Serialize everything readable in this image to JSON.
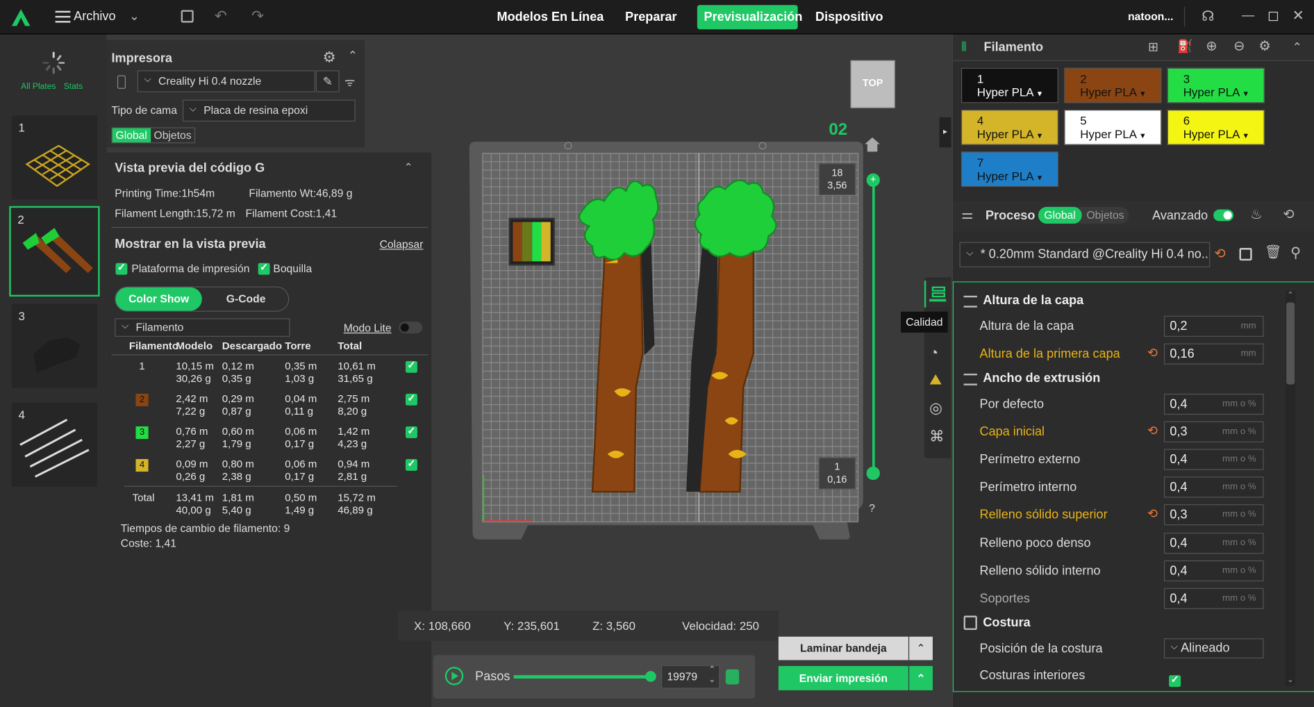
{
  "topbar": {
    "file_label": "Archivo",
    "tabs": [
      "Modelos En Línea",
      "Preparar",
      "Previsualización",
      "Dispositivo"
    ],
    "active_tab": "Previsualización",
    "user": "natoon..."
  },
  "plates": {
    "all_plates": "All Plates",
    "stats": "Stats",
    "items": [
      "1",
      "2",
      "3",
      "4"
    ]
  },
  "printer": {
    "title": "Impresora",
    "printer_name": "Creality Hi 0.4 nozzle",
    "bed_label": "Tipo de cama",
    "bed_value": "Placa de resina epoxi",
    "tab_global": "Global",
    "tab_objects": "Objetos"
  },
  "gcode": {
    "title": "Vista previa del código G",
    "printing_time": "Printing Time:1h54m",
    "filament_wt": "Filamento Wt:46,89 g",
    "filament_length": "Filament Length:15,72 m",
    "filament_cost": "Filament Cost:1,41",
    "show_title": "Mostrar en la vista previa",
    "collapse": "Colapsar",
    "check_platform": "Plataforma de impresión",
    "check_nozzle": "Boquilla",
    "btn_color_show": "Color Show",
    "btn_gcode": "G-Code",
    "filter": "Filamento",
    "modo_lite": "Modo Lite",
    "headers": [
      "Filamento",
      "Modelo",
      "Descargado",
      "Torre",
      "Total"
    ],
    "rows": [
      {
        "id": "1",
        "color": "",
        "modelo": [
          "10,15 m",
          "30,26 g"
        ],
        "descargado": [
          "0,12 m",
          "0,35 g"
        ],
        "torre": [
          "0,35 m",
          "1,03 g"
        ],
        "total": [
          "10,61 m",
          "31,65 g"
        ]
      },
      {
        "id": "2",
        "color": "#8b4513",
        "modelo": [
          "2,42 m",
          "7,22 g"
        ],
        "descargado": [
          "0,29 m",
          "0,87 g"
        ],
        "torre": [
          "0,04 m",
          "0,11 g"
        ],
        "total": [
          "2,75 m",
          "8,20 g"
        ]
      },
      {
        "id": "3",
        "color": "#22dd44",
        "modelo": [
          "0,76 m",
          "2,27 g"
        ],
        "descargado": [
          "0,60 m",
          "1,79 g"
        ],
        "torre": [
          "0,06 m",
          "0,17 g"
        ],
        "total": [
          "1,42 m",
          "4,23 g"
        ]
      },
      {
        "id": "4",
        "color": "#d4b52a",
        "modelo": [
          "0,09 m",
          "0,26 g"
        ],
        "descargado": [
          "0,80 m",
          "2,38 g"
        ],
        "torre": [
          "0,06 m",
          "0,17 g"
        ],
        "total": [
          "0,94 m",
          "2,81 g"
        ]
      }
    ],
    "total_row": {
      "label": "Total",
      "modelo": [
        "13,41 m",
        "40,00 g"
      ],
      "descargado": [
        "1,81 m",
        "5,40 g"
      ],
      "torre": [
        "0,50 m",
        "1,49 g"
      ],
      "total": [
        "15,72 m",
        "46,89 g"
      ]
    },
    "changes": "Tiempos de cambio de filamento:  9",
    "cost": "Coste:  1,41"
  },
  "viewport": {
    "view_cube": "TOP",
    "plate_number": "02",
    "layer_top": [
      "18",
      "3,56"
    ],
    "layer_bottom": [
      "1",
      "0,16"
    ],
    "quality_tooltip": "Calidad",
    "help": "?",
    "coords": {
      "x": "X: 108,660",
      "y": "Y: 235,601",
      "z": "Z: 3,560",
      "speed": "Velocidad: 250"
    },
    "steps_label": "Pasos",
    "steps_value": "19979",
    "steps_fraction": 1.0
  },
  "actions": {
    "slice": "Laminar bandeja",
    "send": "Enviar impresión"
  },
  "filament_panel": {
    "title": "Filamento",
    "items": [
      {
        "n": "1",
        "name": "Hyper PLA",
        "bg": "#111111",
        "fg": "#ffffff"
      },
      {
        "n": "2",
        "name": "Hyper PLA",
        "bg": "#8b4513",
        "fg": "#111111"
      },
      {
        "n": "3",
        "name": "Hyper PLA",
        "bg": "#22dd44",
        "fg": "#111111"
      },
      {
        "n": "4",
        "name": "Hyper PLA",
        "bg": "#d4b52a",
        "fg": "#111111"
      },
      {
        "n": "5",
        "name": "Hyper PLA",
        "bg": "#ffffff",
        "fg": "#111111"
      },
      {
        "n": "6",
        "name": "Hyper PLA",
        "bg": "#f5f514",
        "fg": "#111111"
      },
      {
        "n": "7",
        "name": "Hyper PLA",
        "bg": "#1e7fc8",
        "fg": "#111111"
      }
    ]
  },
  "process": {
    "title": "Proceso",
    "tab_global": "Global",
    "tab_objects": "Objetos",
    "advanced": "Avanzado",
    "preset": "* 0.20mm Standard @Creality Hi 0.4 no...",
    "layer_section": "Altura de la capa",
    "layer_height_label": "Altura de la capa",
    "layer_height_value": "0,2",
    "first_layer_label": "Altura de la primera capa",
    "first_layer_value": "0,16",
    "unit_mm": "mm",
    "unit_mmpct": "mm o %",
    "width_section": "Ancho de extrusión",
    "widths": [
      {
        "label": "Por defecto",
        "value": "0,4",
        "mod": false
      },
      {
        "label": "Capa inicial",
        "value": "0,3",
        "mod": true
      },
      {
        "label": "Perímetro externo",
        "value": "0,4",
        "mod": false
      },
      {
        "label": "Perímetro interno",
        "value": "0,4",
        "mod": false
      },
      {
        "label": "Relleno sólido superior",
        "value": "0,3",
        "mod": true
      },
      {
        "label": "Relleno poco denso",
        "value": "0,4",
        "mod": false
      },
      {
        "label": "Relleno sólido interno",
        "value": "0,4",
        "mod": false
      },
      {
        "label": "Soportes",
        "value": "0,4",
        "mod": false
      }
    ],
    "seam_section": "Costura",
    "seam_pos_label": "Posición de la costura",
    "seam_pos_value": "Alineado",
    "inner_seams_label": "Costuras interiores"
  },
  "colors": {
    "accent": "#1fc865",
    "modified": "#e8b317"
  }
}
